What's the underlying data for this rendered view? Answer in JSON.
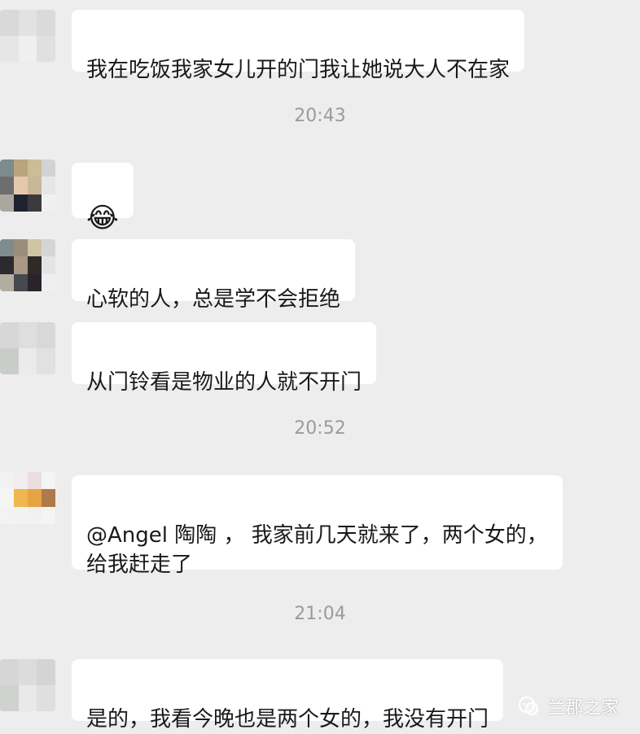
{
  "messages": [
    {
      "text": "我在吃饭我家女儿开的门我让她说大人不在家"
    },
    {
      "text": "😂"
    },
    {
      "text": "心软的人，总是学不会拒绝"
    },
    {
      "text": "从门铃看是物业的人就不开门"
    },
    {
      "text": "@Angel 陶陶 ， 我家前几天就来了，两个女的，\n给我赶走了"
    },
    {
      "text": "是的，我看今晚也是两个女的，我没有开门"
    }
  ],
  "timestamps": [
    "20:43",
    "20:52",
    "21:04"
  ],
  "watermark": {
    "text": "兰郡之家",
    "icon": "wechat-official-account-icon"
  },
  "colors": {
    "background": "#ededed",
    "bubble": "#ffffff",
    "text": "#191919",
    "timestamp": "#9b9b9b"
  }
}
